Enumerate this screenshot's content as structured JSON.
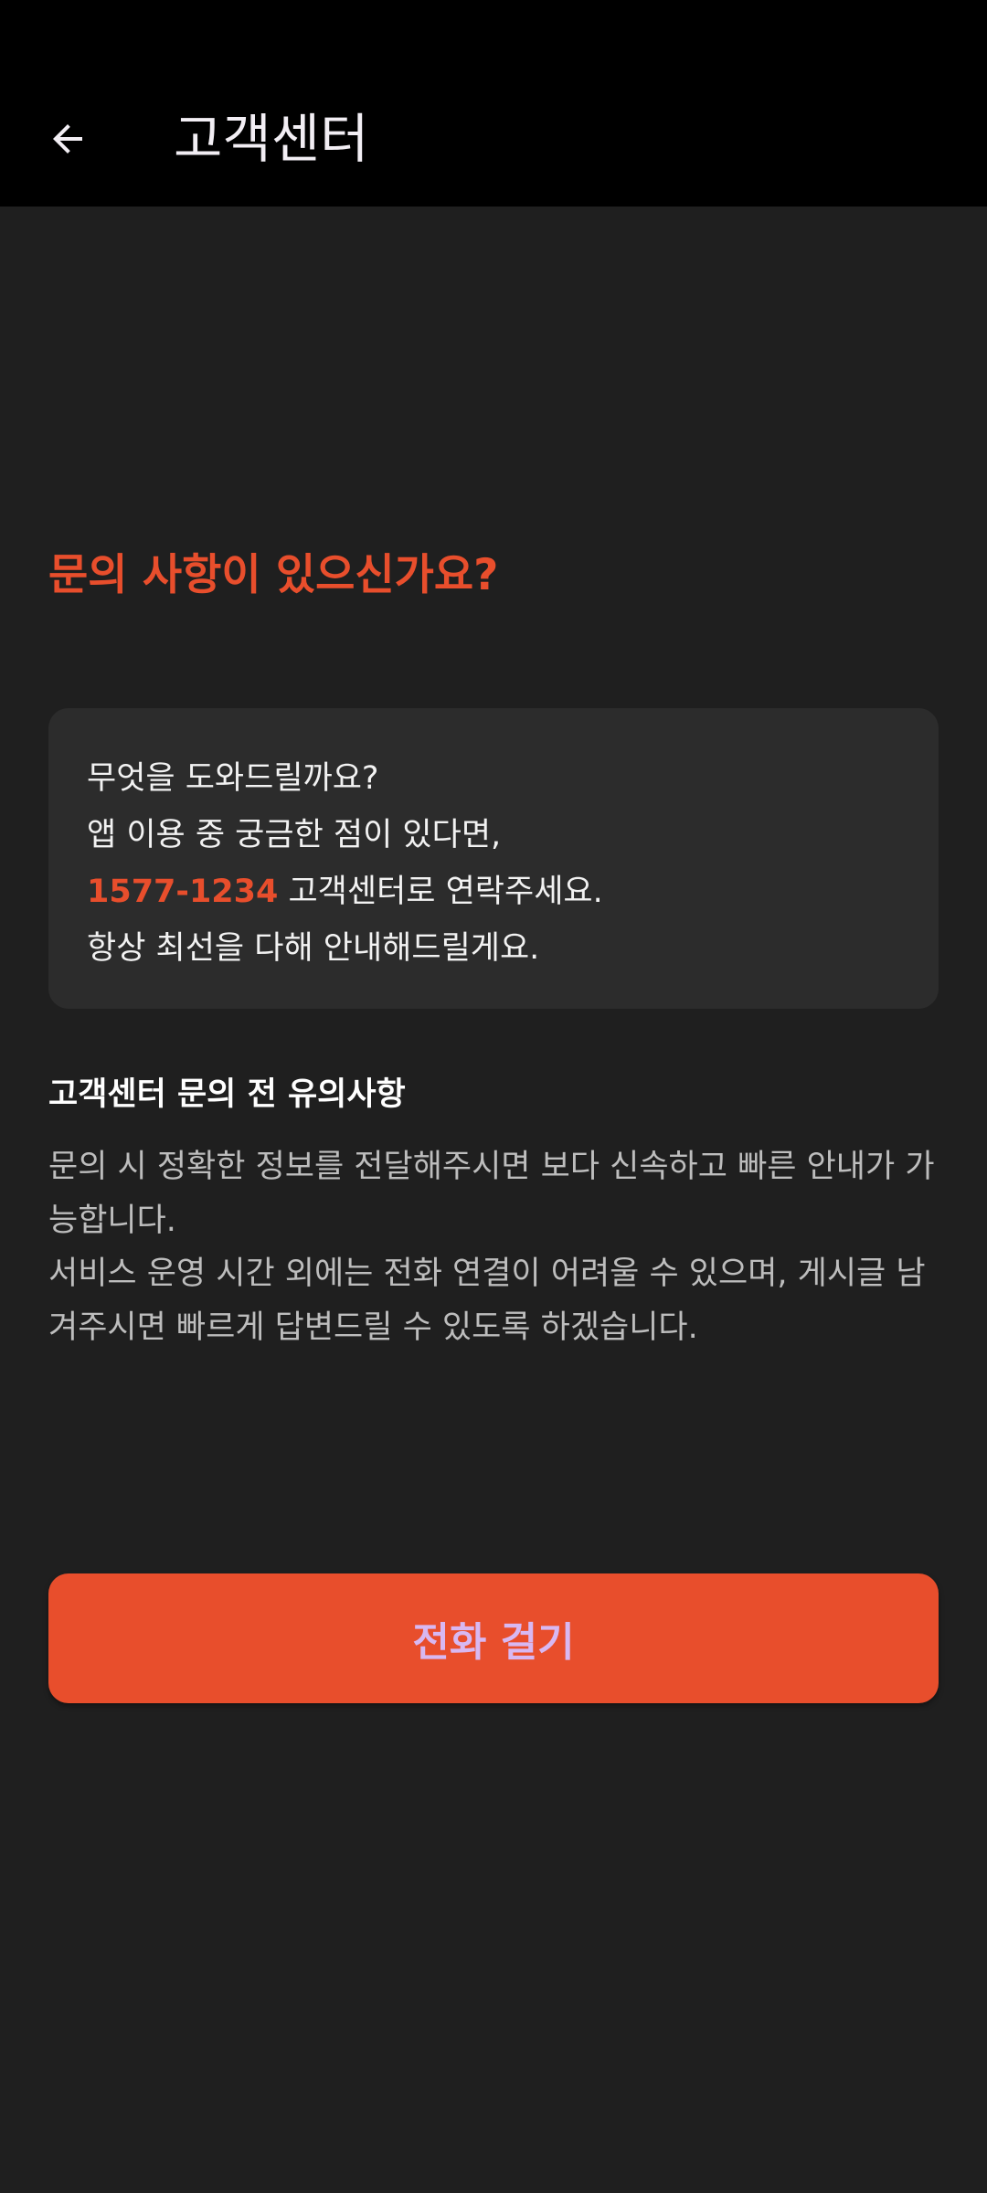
{
  "appbar": {
    "title": "고객센터",
    "back_icon": "arrow-left-icon"
  },
  "heading": "문의 사항이 있으신가요?",
  "info_card": {
    "line1": "무엇을 도와드릴까요?",
    "line2": "앱 이용 중 궁금한 점이 있다면,",
    "phone": "1577-1234",
    "line3_rest": " 고객센터로 연락주세요.",
    "line4": "항상 최선을 다해 안내해드릴게요."
  },
  "notice": {
    "title": "고객센터 문의 전 유의사항",
    "paragraph1": "문의 시 정확한 정보를 전달해주시면 보다 신속하고 빠른 안내가 가능합니다.",
    "paragraph2": "서비스 운영 시간 외에는 전화 연결이 어려울 수 있으며, 게시글 남겨주시면 빠르게 답변드릴 수 있도록 하겠습니다."
  },
  "call_button": {
    "label": "전화 걸기"
  },
  "colors": {
    "accent": "#e84e2c",
    "background": "#1f1f1f",
    "card": "#2c2c2c",
    "button_text": "#d8b8f2"
  }
}
